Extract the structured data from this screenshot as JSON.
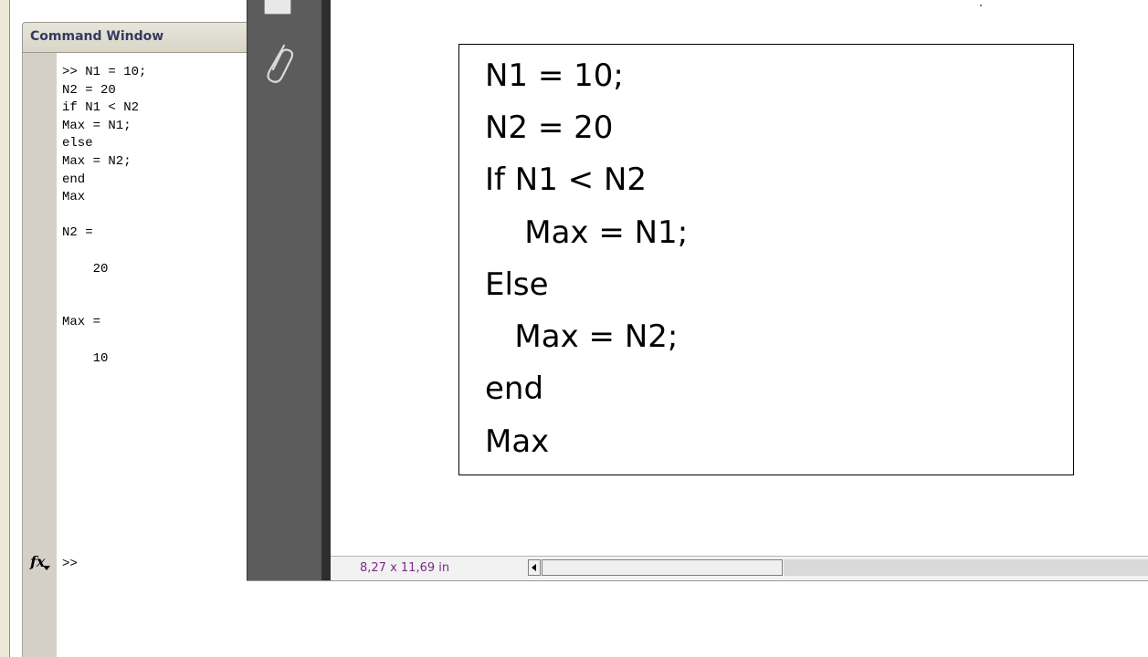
{
  "command_window": {
    "title": "Command Window",
    "history": ">> N1 = 10;\nN2 = 20\nif N1 < N2\nMax = N1;\nelse\nMax = N2;\nend\nMax\n\nN2 =\n\n    20\n\n\nMax =\n\n    10",
    "fx_label": "fx",
    "prompt": ">>"
  },
  "document": {
    "code_lines": [
      "N1 = 10;",
      "N2 = 20",
      "If N1 < N2",
      "    Max = N1;",
      "Else",
      "   Max = N2;",
      "end",
      "Max"
    ]
  },
  "status_bar": {
    "page_size": "8,27 x 11,69 in"
  },
  "icons": {
    "pages": "pages-panel-icon",
    "attachments": "paperclip-icon",
    "function_browser": "fx-icon",
    "scroll_left": "scroll-left-arrow-icon"
  }
}
